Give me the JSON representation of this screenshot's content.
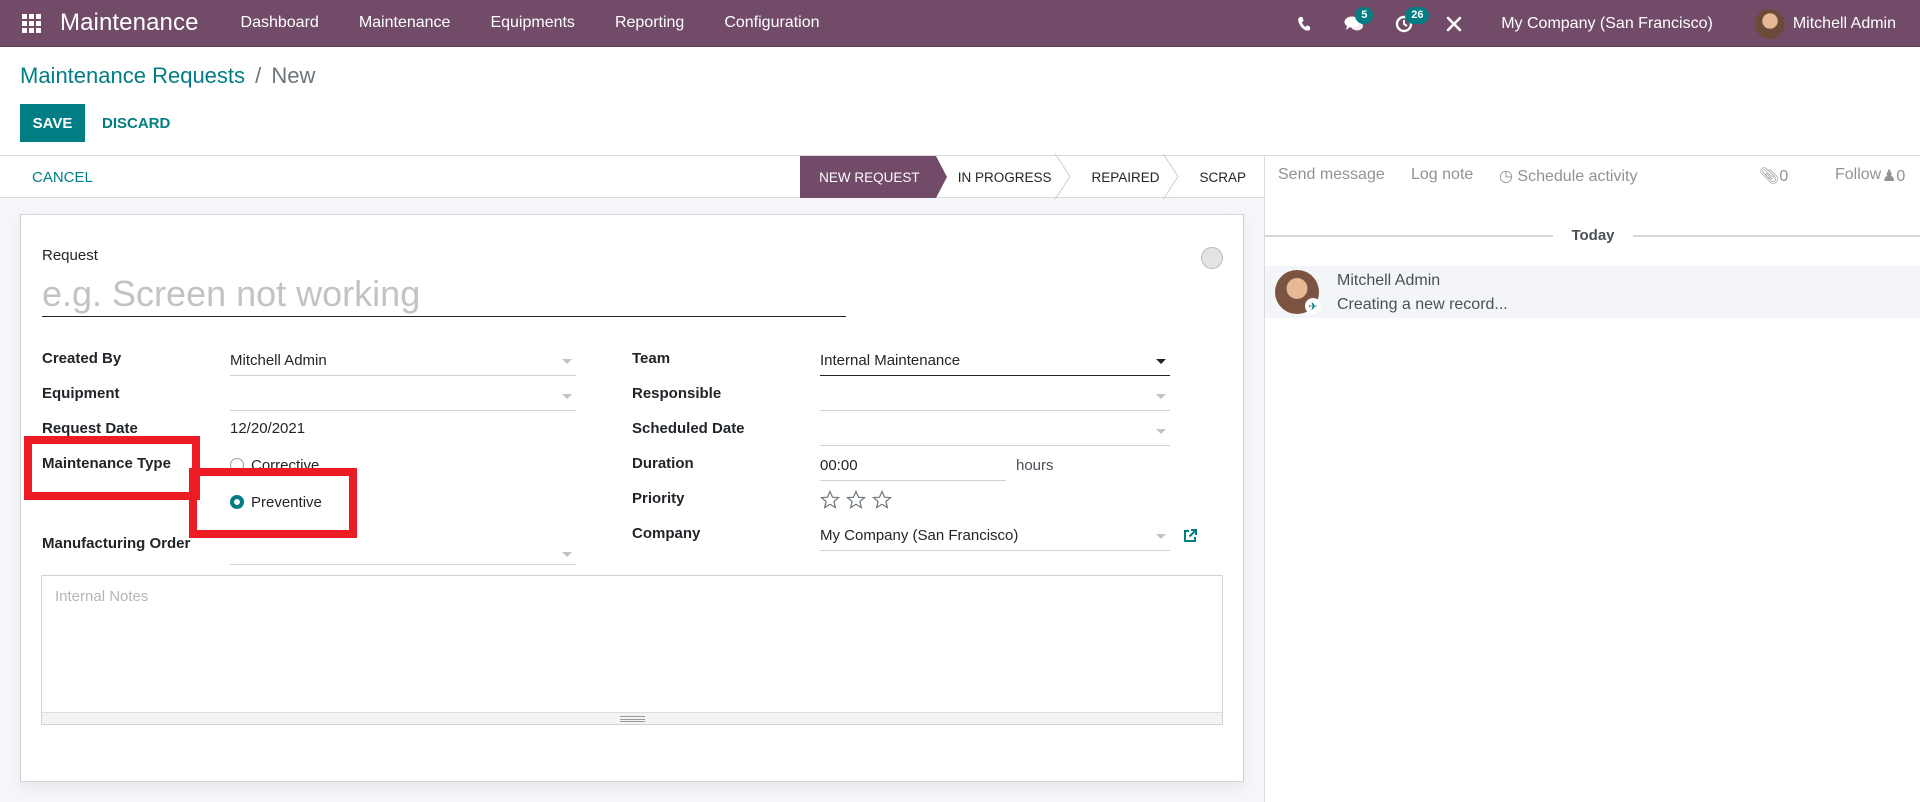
{
  "navbar": {
    "app_name": "Maintenance",
    "menu": [
      "Dashboard",
      "Maintenance",
      "Equipments",
      "Reporting",
      "Configuration"
    ],
    "messages_count": "5",
    "activities_count": "26",
    "company": "My Company (San Francisco)",
    "user": "Mitchell Admin",
    "icons": [
      "apps-grid-icon",
      "phone-icon",
      "chat-bubbles-icon",
      "clock-activity-icon",
      "tools-icon"
    ]
  },
  "breadcrumb": {
    "parent": "Maintenance Requests",
    "separator": "/",
    "current": "New"
  },
  "actions": {
    "save": "SAVE",
    "discard": "DISCARD"
  },
  "statusbar": {
    "cancel": "CANCEL",
    "stages": [
      {
        "label": "NEW REQUEST",
        "active": true
      },
      {
        "label": "IN PROGRESS",
        "active": false
      },
      {
        "label": "REPAIRED",
        "active": false
      },
      {
        "label": "SCRAP",
        "active": false
      }
    ]
  },
  "form": {
    "request_label": "Request",
    "request_placeholder": "e.g. Screen not working",
    "request_value": "",
    "left": {
      "created_by": {
        "label": "Created By",
        "value": "Mitchell Admin"
      },
      "equipment": {
        "label": "Equipment",
        "value": ""
      },
      "request_date": {
        "label": "Request Date",
        "value": "12/20/2021"
      },
      "maintenance_type": {
        "label": "Maintenance Type",
        "options": [
          "Corrective",
          "Preventive"
        ],
        "selected": "Preventive"
      },
      "manufacturing_order": {
        "label": "Manufacturing Order",
        "value": ""
      }
    },
    "right": {
      "team": {
        "label": "Team",
        "value": "Internal Maintenance"
      },
      "responsible": {
        "label": "Responsible",
        "value": ""
      },
      "scheduled_date": {
        "label": "Scheduled Date",
        "value": ""
      },
      "duration": {
        "label": "Duration",
        "value": "00:00",
        "unit": "hours"
      },
      "priority": {
        "label": "Priority",
        "stars_total": 3,
        "stars_selected": 0
      },
      "company": {
        "label": "Company",
        "value": "My Company (San Francisco)"
      }
    },
    "notes_placeholder": "Internal Notes"
  },
  "chatter": {
    "send_message": "Send message",
    "log_note": "Log note",
    "schedule_activity": "Schedule activity",
    "attachments_count": "0",
    "follow": "Follow",
    "followers_count": "0",
    "date_separator": "Today",
    "messages": [
      {
        "author": "Mitchell Admin",
        "body": "Creating a new record..."
      }
    ]
  },
  "colors": {
    "brand": "#714B67",
    "accent": "#017E84",
    "highlight": "#ED1C24"
  }
}
